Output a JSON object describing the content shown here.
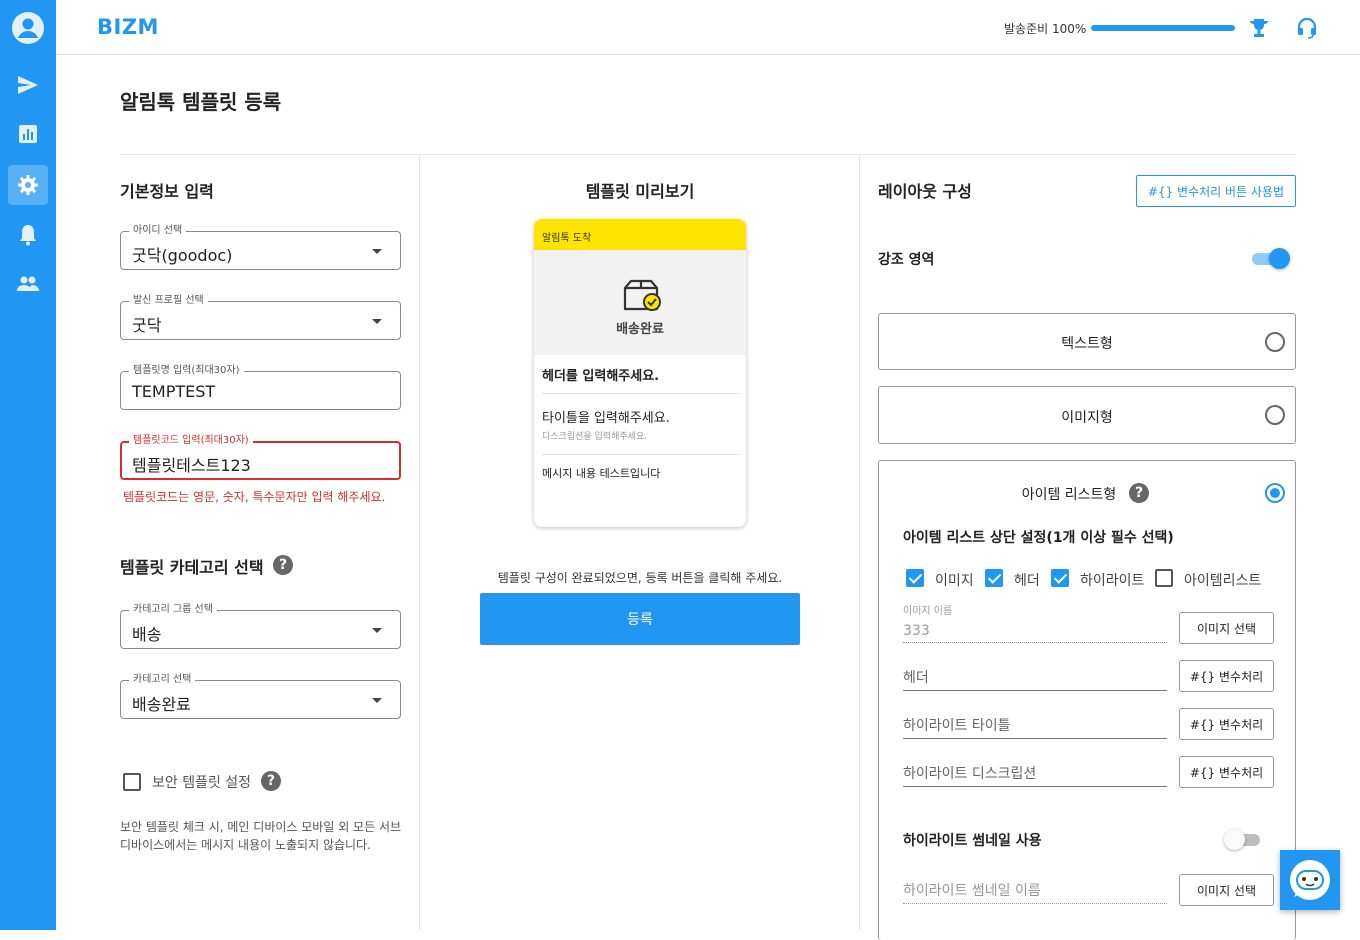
{
  "nav": {
    "items": [
      {
        "icon": "user-avatar-icon"
      },
      {
        "icon": "send-icon"
      },
      {
        "icon": "bar-chart-icon"
      },
      {
        "icon": "gear-icon",
        "active": true
      },
      {
        "icon": "bell-icon"
      },
      {
        "icon": "people-icon"
      }
    ]
  },
  "header": {
    "brand": "BIZM",
    "ready_label": "발송준비 100%",
    "ready_progress": 1.0,
    "icons": [
      "trophy-icon",
      "headset-icon"
    ]
  },
  "page": {
    "title": "알림톡 템플릿 등록"
  },
  "basic": {
    "title": "기본정보 입력",
    "id_select": {
      "label": "아이디 선택",
      "value": "굿닥(goodoc)"
    },
    "profile_select": {
      "label": "발신 프로필 선택",
      "value": "굿닥"
    },
    "template_name": {
      "label": "템플릿명 입력(최대30자)",
      "value": "TEMPTEST"
    },
    "template_code": {
      "label": "템플릿코드 입력(최대30자)",
      "value": "템플릿테스트123",
      "error": "템플릿코드는 영문, 숫자, 특수문자만 입력 해주세요."
    },
    "category_title": "템플릿 카테고리 선택",
    "category_group": {
      "label": "카테고리 그룹 선택",
      "value": "배송"
    },
    "category": {
      "label": "카테고리 선택",
      "value": "배송완료"
    },
    "secure_label": "보안 템플릿 설정",
    "secure_note": "보안 템플릿 체크 시, 메인 디바이스 모바일 외 모든 서브 디바이스에서는 메시지 내용이 노출되지 않습니다.",
    "help_glyph": "?"
  },
  "preview": {
    "title": "템플릿 미리보기",
    "head": "알림톡 도착",
    "image_label": "배송완료",
    "header_text": "헤더를 입력해주세요.",
    "title_text": "타이틀을 입력해주세요.",
    "desc_text": "디스크립션을 입력해주세요.",
    "message": "메시지 내용 테스트입니다",
    "hint": "템플릿 구성이 완료되었으면, 등록 버튼을 클릭해 주세요.",
    "submit_label": "등록"
  },
  "layout": {
    "title": "레이아웃 구성",
    "var_help_button": "#{} 변수처리 버튼 사용법",
    "emphasis_label": "강조 영역",
    "emphasis_on": true,
    "options": [
      {
        "label": "텍스트형",
        "selected": false
      },
      {
        "label": "이미지형",
        "selected": false
      },
      {
        "label": "아이템 리스트형",
        "selected": true
      }
    ],
    "item_list": {
      "top_setting_title": "아이템 리스트 상단 설정(1개 이상 필수 선택)",
      "checks": [
        {
          "label": "이미지",
          "checked": true
        },
        {
          "label": "헤더",
          "checked": true
        },
        {
          "label": "하이라이트",
          "checked": true
        },
        {
          "label": "아이템리스트",
          "checked": false
        }
      ],
      "image_name_label": "이미지 이름",
      "image_name_value": "333",
      "image_select_button": "이미지 선택",
      "header_placeholder": "헤더",
      "highlight_title_placeholder": "하이라이트 타이틀",
      "highlight_desc_placeholder": "하이라이트 디스크립션",
      "var_button": "#{} 변수처리",
      "thumb_title": "하이라이트 썸네일 사용",
      "thumb_on": false,
      "thumb_name_placeholder": "하이라이트 썸네일 이름",
      "thumb_select_button": "이미지 선택"
    }
  },
  "chat": {
    "icon": "chat-bot-icon"
  }
}
